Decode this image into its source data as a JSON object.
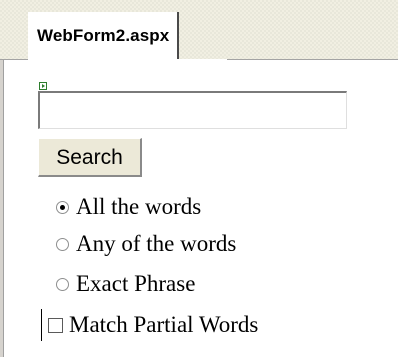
{
  "tab": {
    "title": "WebForm2.aspx"
  },
  "search": {
    "input_value": "",
    "button_label": "Search"
  },
  "options": {
    "all_words": {
      "label": "All the words",
      "selected": true
    },
    "any_words": {
      "label": "Any of the words",
      "selected": false
    },
    "exact_phrase": {
      "label": "Exact Phrase",
      "selected": false
    },
    "match_partial": {
      "label": "Match Partial Words",
      "checked": false
    }
  },
  "icons": {
    "component_glyph": "control-glyph-icon"
  }
}
